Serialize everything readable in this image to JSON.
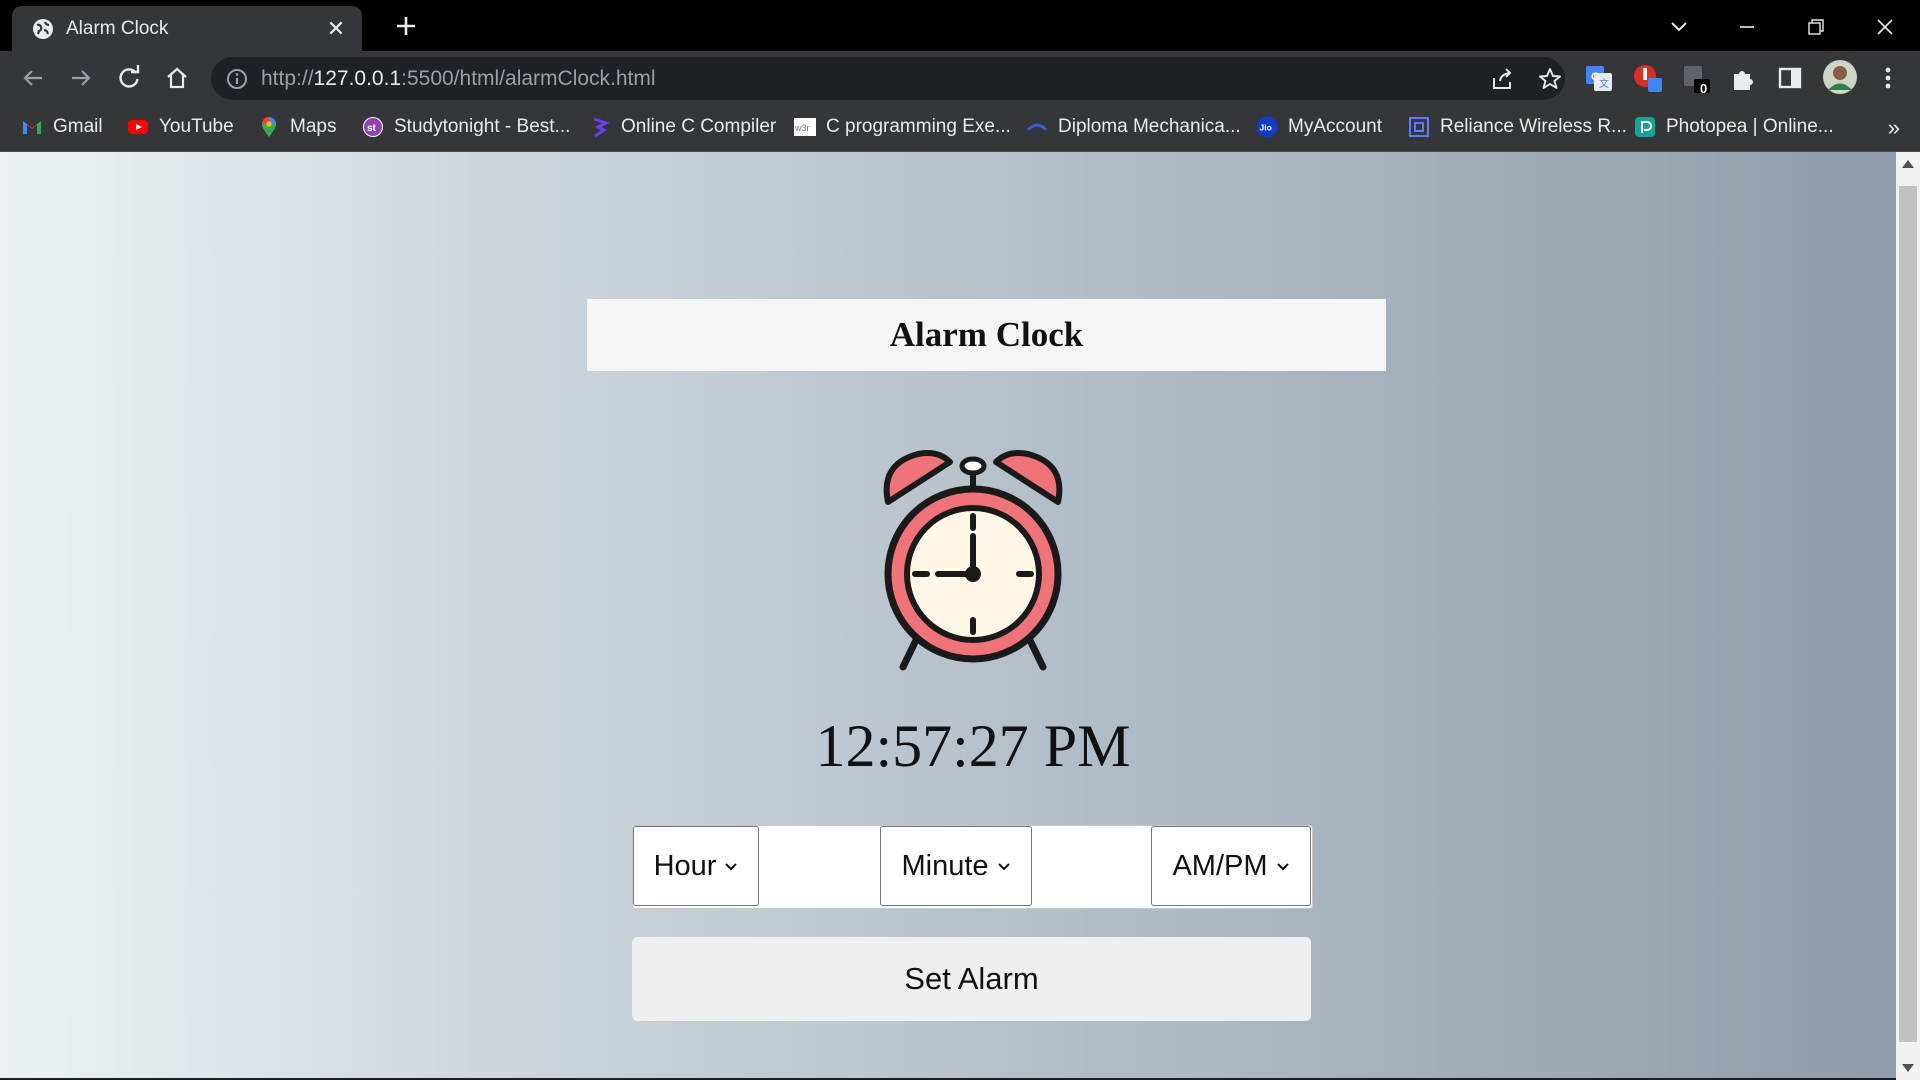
{
  "browser": {
    "tab": {
      "title": "Alarm Clock",
      "close": "✕"
    },
    "url": {
      "scheme": "http://",
      "host": "127.0.0.1",
      "rest": ":5500/html/alarmClock.html"
    },
    "extension_badge": "0",
    "bookmarks": [
      {
        "label": "Gmail",
        "icon": "gmail-icon",
        "color": "#ea4335"
      },
      {
        "label": "YouTube",
        "icon": "youtube-icon",
        "color": "#ff0000"
      },
      {
        "label": "Maps",
        "icon": "maps-icon",
        "color": "#34a853"
      },
      {
        "label": "Studytonight - Best...",
        "icon": "studytonight-icon",
        "color": "#8e44ad"
      },
      {
        "label": "Online C Compiler",
        "icon": "compiler-icon",
        "color": "#6c3df5"
      },
      {
        "label": "C programming Exe...",
        "icon": "w3r-icon",
        "color": "#ffffff"
      },
      {
        "label": "Diploma Mechanica...",
        "icon": "diploma-icon",
        "color": "#3b5bdb"
      },
      {
        "label": "MyAccount",
        "icon": "jio-icon",
        "color": "#0f3cc9"
      },
      {
        "label": "Reliance Wireless R...",
        "icon": "reliance-icon",
        "color": "#5c7cfa"
      },
      {
        "label": "Photopea | Online...",
        "icon": "photopea-icon",
        "color": "#18a497"
      }
    ],
    "bookmarks_more": "»"
  },
  "app": {
    "title": "Alarm Clock",
    "current_time": "12:57:27 PM",
    "selects": {
      "hour": "Hour",
      "minute": "Minute",
      "ampm": "AM/PM"
    },
    "set_button": "Set Alarm",
    "colors": {
      "clock_red": "#f0737a",
      "clock_face": "#fff8e7",
      "outline": "#1a1a1a"
    }
  }
}
